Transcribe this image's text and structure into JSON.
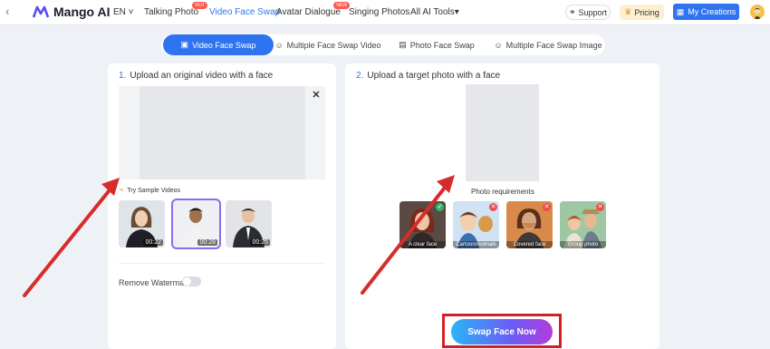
{
  "header": {
    "back_icon": "chevron-left-icon",
    "brand": "Mango AI",
    "language": "EN",
    "nav": [
      {
        "label": "Talking Photo",
        "badge": "HOT"
      },
      {
        "label": "Video Face Swap",
        "badge": ""
      },
      {
        "label": "Avatar Dialogue",
        "badge": "NEW"
      },
      {
        "label": "Singing Photos",
        "badge": ""
      },
      {
        "label": "All AI Tools",
        "badge": ""
      }
    ],
    "support_label": "Support",
    "pricing_label": "Pricing",
    "creations_label": "My Creations",
    "accent_color": "#2e74f0"
  },
  "tabs": [
    {
      "label": "Video Face Swap",
      "icon": "video-icon"
    },
    {
      "label": "Multiple Face Swap Video",
      "icon": "multi-face-icon"
    },
    {
      "label": "Photo Face Swap",
      "icon": "image-icon"
    },
    {
      "label": "Multiple Face Swap Image",
      "icon": "multi-face-icon"
    }
  ],
  "left_panel": {
    "step_number": "1.",
    "title": "Upload an original video with a face",
    "sample_label": "Try Sample Videos",
    "samples": [
      {
        "duration": "00:22"
      },
      {
        "duration": "00:28"
      },
      {
        "duration": "00:25"
      }
    ],
    "watermark_label": "Remove Watermark"
  },
  "right_panel": {
    "step_number": "2.",
    "title": "Upload a target photo with a face",
    "requirements_label": "Photo requirements",
    "requirements": [
      {
        "caption": "A clear face",
        "status": "ok"
      },
      {
        "caption": "Cartoon/Animals",
        "status": "bad"
      },
      {
        "caption": "Covered face",
        "status": "bad"
      },
      {
        "caption": "Group photo",
        "status": "bad"
      }
    ],
    "swap_button": "Swap Face Now"
  }
}
